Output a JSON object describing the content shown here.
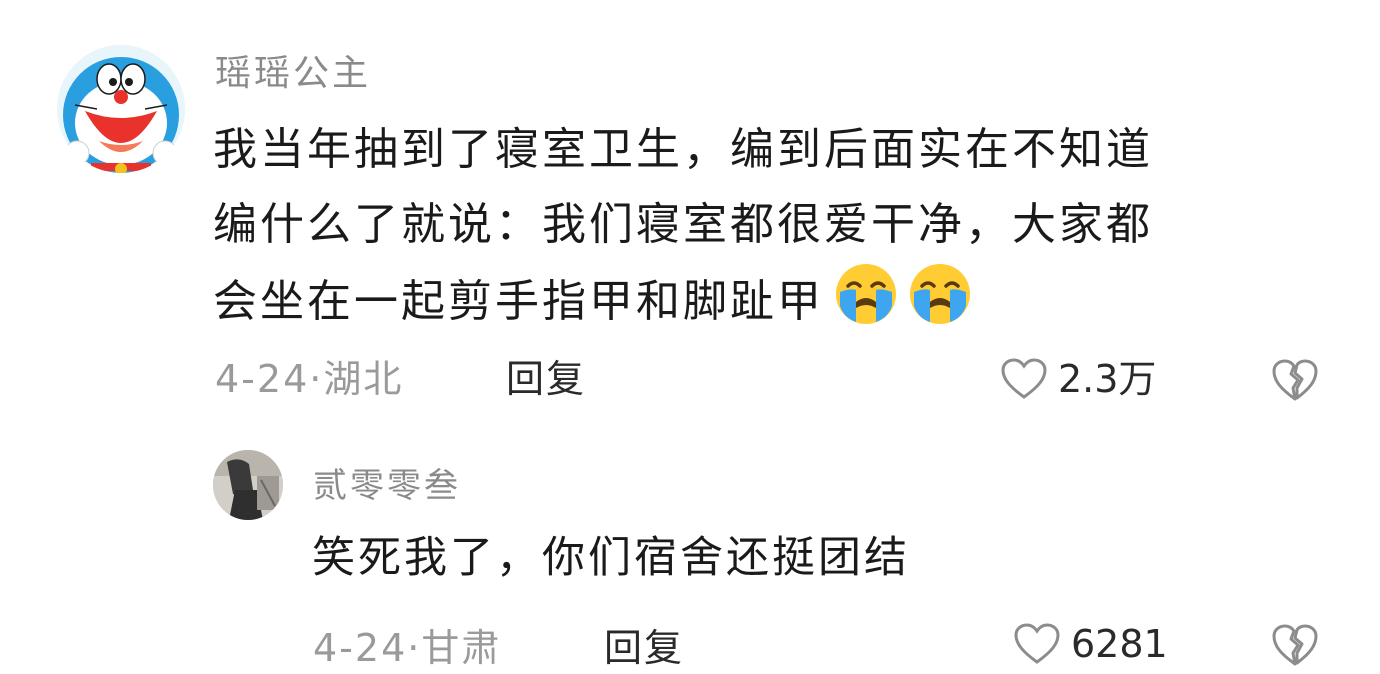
{
  "comment": {
    "username": "瑶瑶公主",
    "text_lines": [
      "我当年抽到了寝室卫生，编到后面实在不知道",
      "编什么了就说：我们寝室都很爱干净，大家都",
      "会坐在一起剪手指甲和脚趾甲"
    ],
    "emojis": [
      "crying-face-icon",
      "crying-face-icon"
    ],
    "date_location": "4-24·湖北",
    "reply_label": "回复",
    "like_count": "2.3万"
  },
  "reply": {
    "username": "贰零零叁",
    "text": "笑死我了，你们宿舍还挺团结",
    "date_location": "4-24·甘肃",
    "reply_label": "回复",
    "like_count": "6281"
  },
  "colors": {
    "username": "#8a8a8a",
    "body": "#1a1a1a",
    "meta": "#9a9a9a",
    "icon": "#8c8c8c"
  }
}
